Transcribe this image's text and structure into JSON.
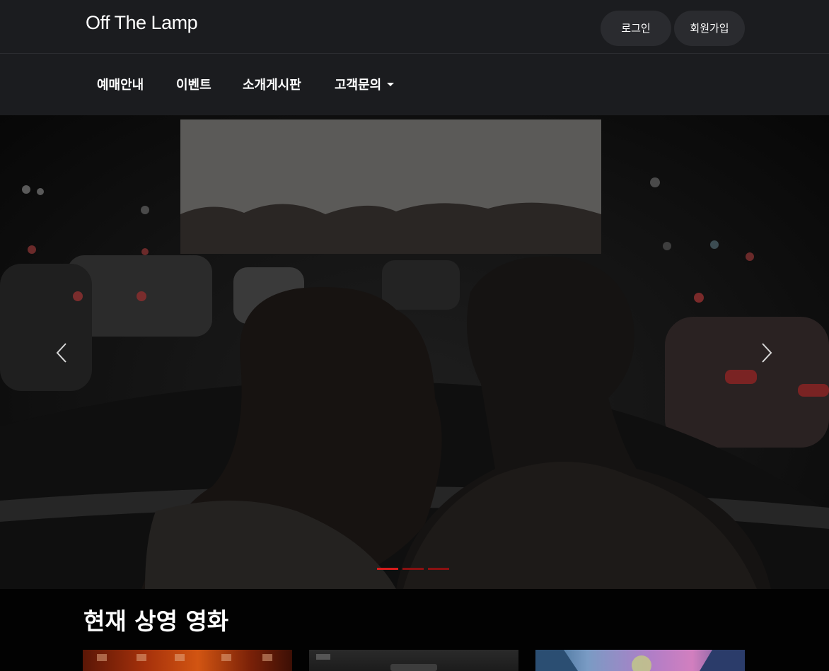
{
  "header": {
    "logo": "Off The Lamp",
    "login_label": "로그인",
    "signup_label": "회원가입"
  },
  "nav": {
    "items": [
      {
        "label": "예매안내",
        "has_dropdown": false
      },
      {
        "label": "이벤트",
        "has_dropdown": false
      },
      {
        "label": "소개게시판",
        "has_dropdown": false
      },
      {
        "label": "고객문의",
        "has_dropdown": true
      }
    ]
  },
  "carousel": {
    "slide_count": 3,
    "active_index": 0,
    "prev_icon": "chevron-left-icon",
    "next_icon": "chevron-right-icon"
  },
  "now_showing": {
    "title": "현재 상영 영화",
    "posters": [
      {
        "name": "poster-1"
      },
      {
        "name": "poster-2"
      },
      {
        "name": "poster-3"
      }
    ]
  },
  "colors": {
    "header_bg": "#1b1c1f",
    "page_bg": "#020202",
    "indicator_active": "#d61c1c",
    "indicator_inactive": "#8c1111",
    "pill_bg": "#2a2b2f"
  }
}
